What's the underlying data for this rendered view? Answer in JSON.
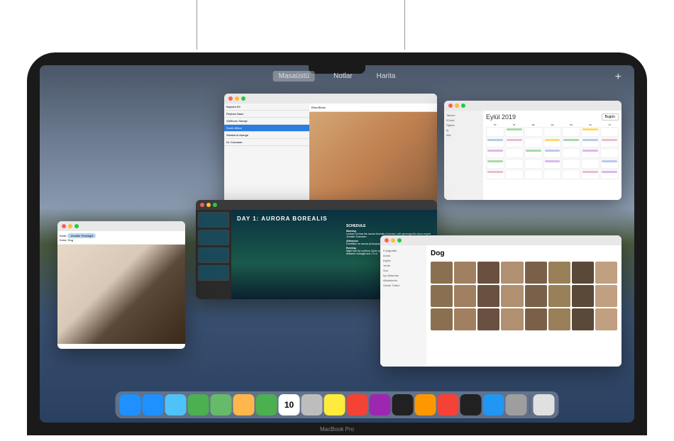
{
  "laptop_label": "MacBook Pro",
  "spaces": {
    "items": [
      "Masaüstü",
      "Notlar",
      "Harita"
    ],
    "add": "+"
  },
  "mail": {
    "from": "Eliza Block",
    "items": [
      "Bayram Eti",
      "Reyhan Nasır",
      "Geliboruı Sanayi",
      "South Africa",
      "Weekend change",
      "Dr. Kumaran"
    ],
    "selected_idx": 3
  },
  "calendar": {
    "title": "Eylül 2019",
    "today": "Bugün",
    "days": [
      "Pz",
      "Pt",
      "Sa",
      "Ça",
      "Pe",
      "Cu",
      "Ct"
    ],
    "side": [
      "Takvim",
      "iCloud",
      "Öğeler",
      "İş",
      "Aile"
    ]
  },
  "keynote": {
    "title": "DAY 1: AURORA BOREALIS",
    "schedule_label": "SCHEDULE",
    "morning": "Morning",
    "morning_txt": "Lecture on how the aurora borealis is formed, with geomagnetic storm expert Jennifer Sorensen",
    "afternoon": "Afternoon",
    "afternoon_txt": "Exhibition on aurora photography",
    "evening": "Evening",
    "evening_txt": "Night tour for northern lights spotting; best time to see the northern lights is between midnight and 2 a.m."
  },
  "compose": {
    "to_label": "Kime:",
    "to_name": "Jennifer Federighi",
    "subject": "Konu:",
    "body": "Dog"
  },
  "photos": {
    "title": "Dog",
    "side": [
      "Fotoğraflar",
      "Anılar",
      "Kişiler",
      "Yerler",
      "Son",
      "İçe Aktarılan",
      "Albümlerim",
      "Ortam Türleri"
    ]
  },
  "dock": {
    "icons": [
      "finder",
      "safari",
      "mail",
      "messages",
      "maps",
      "photos",
      "facetime",
      "calendar",
      "contacts",
      "notes",
      "music",
      "podcasts",
      "tv",
      "appstore-dev",
      "news",
      "stocks",
      "appstore",
      "settings",
      "trash"
    ]
  }
}
